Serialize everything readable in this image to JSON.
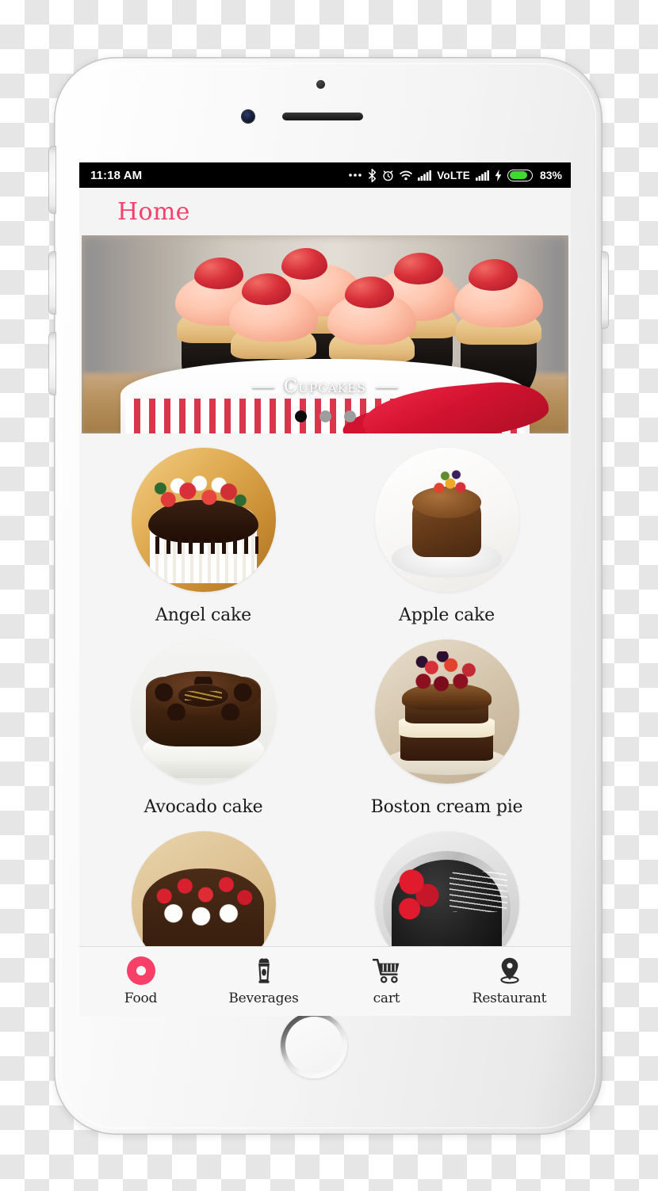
{
  "device": {
    "hardware": {
      "silent_switch": "silent-switch",
      "volume_up": "volume-up-button",
      "volume_down": "volume-down-button",
      "power": "power-button",
      "home": "home-button",
      "camera": "front-camera",
      "earpiece": "earpiece-speaker",
      "sensor": "proximity-sensor"
    }
  },
  "status_bar": {
    "time": "11:18 AM",
    "network_label": "VoLTE",
    "battery_percent": "83%",
    "battery_level": 83,
    "icons": [
      "more-overflow-icon",
      "bluetooth-icon",
      "alarm-clock-icon",
      "wifi-icon",
      "signal-bars-icon",
      "signal-bars-secondary-icon",
      "charging-bolt-icon",
      "battery-icon"
    ]
  },
  "app_bar": {
    "title": "Home",
    "title_color": "#f2416b"
  },
  "banner": {
    "caption": "Cupcakes",
    "dots_total": 3,
    "active_dot": 1,
    "alt": "strawberry-topped cupcakes on a white cake stand with red ribbon"
  },
  "products": [
    {
      "label": "Angel cake",
      "art": "art-angel",
      "name": "product-angel-cake"
    },
    {
      "label": "Apple cake",
      "art": "art-apple",
      "name": "product-apple-cake"
    },
    {
      "label": "Avocado cake",
      "art": "art-avo",
      "name": "product-avocado-cake"
    },
    {
      "label": "Boston cream pie",
      "art": "art-bos",
      "name": "product-boston-cream-pie"
    },
    {
      "label": "",
      "art": "art-bf",
      "name": "product-black-forest-cake"
    },
    {
      "label": "",
      "art": "art-heart",
      "name": "product-heart-cake"
    }
  ],
  "bottom_nav": {
    "active_index": 0,
    "items": [
      {
        "label": "Food",
        "icon": "donut-icon"
      },
      {
        "label": "Beverages",
        "icon": "milkshake-icon"
      },
      {
        "label": "cart",
        "icon": "shopping-cart-icon"
      },
      {
        "label": "Restaurant",
        "icon": "location-pin-icon"
      }
    ]
  },
  "colors": {
    "accent_pink": "#f73f67",
    "title_pink": "#f2416b",
    "screen_bg": "#f5f5f5",
    "nav_bg": "#f7f7f7",
    "status_bg": "#000000",
    "battery_green": "#3ddb2e"
  }
}
